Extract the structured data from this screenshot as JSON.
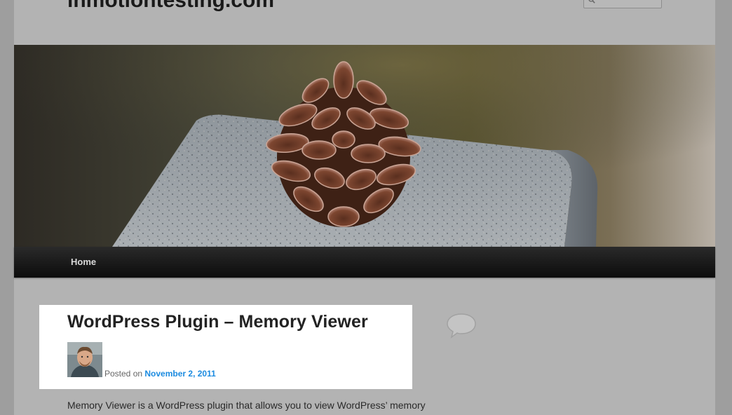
{
  "site": {
    "title": "inmotiontesting.com"
  },
  "search": {
    "icon": "search-icon"
  },
  "header_image": {
    "icon": "pinecone-on-granite-image"
  },
  "nav": {
    "items": [
      {
        "label": "Home"
      }
    ]
  },
  "post": {
    "title": "WordPress Plugin – Memory Viewer",
    "posted_on_label": "Posted on",
    "date": "November 2, 2011",
    "excerpt": "Memory Viewer is a WordPress plugin that allows you to view WordPress’ memory"
  },
  "colors": {
    "page_background": "#b3b3b3",
    "nav_background": "#111111",
    "link": "#1b8be0"
  }
}
